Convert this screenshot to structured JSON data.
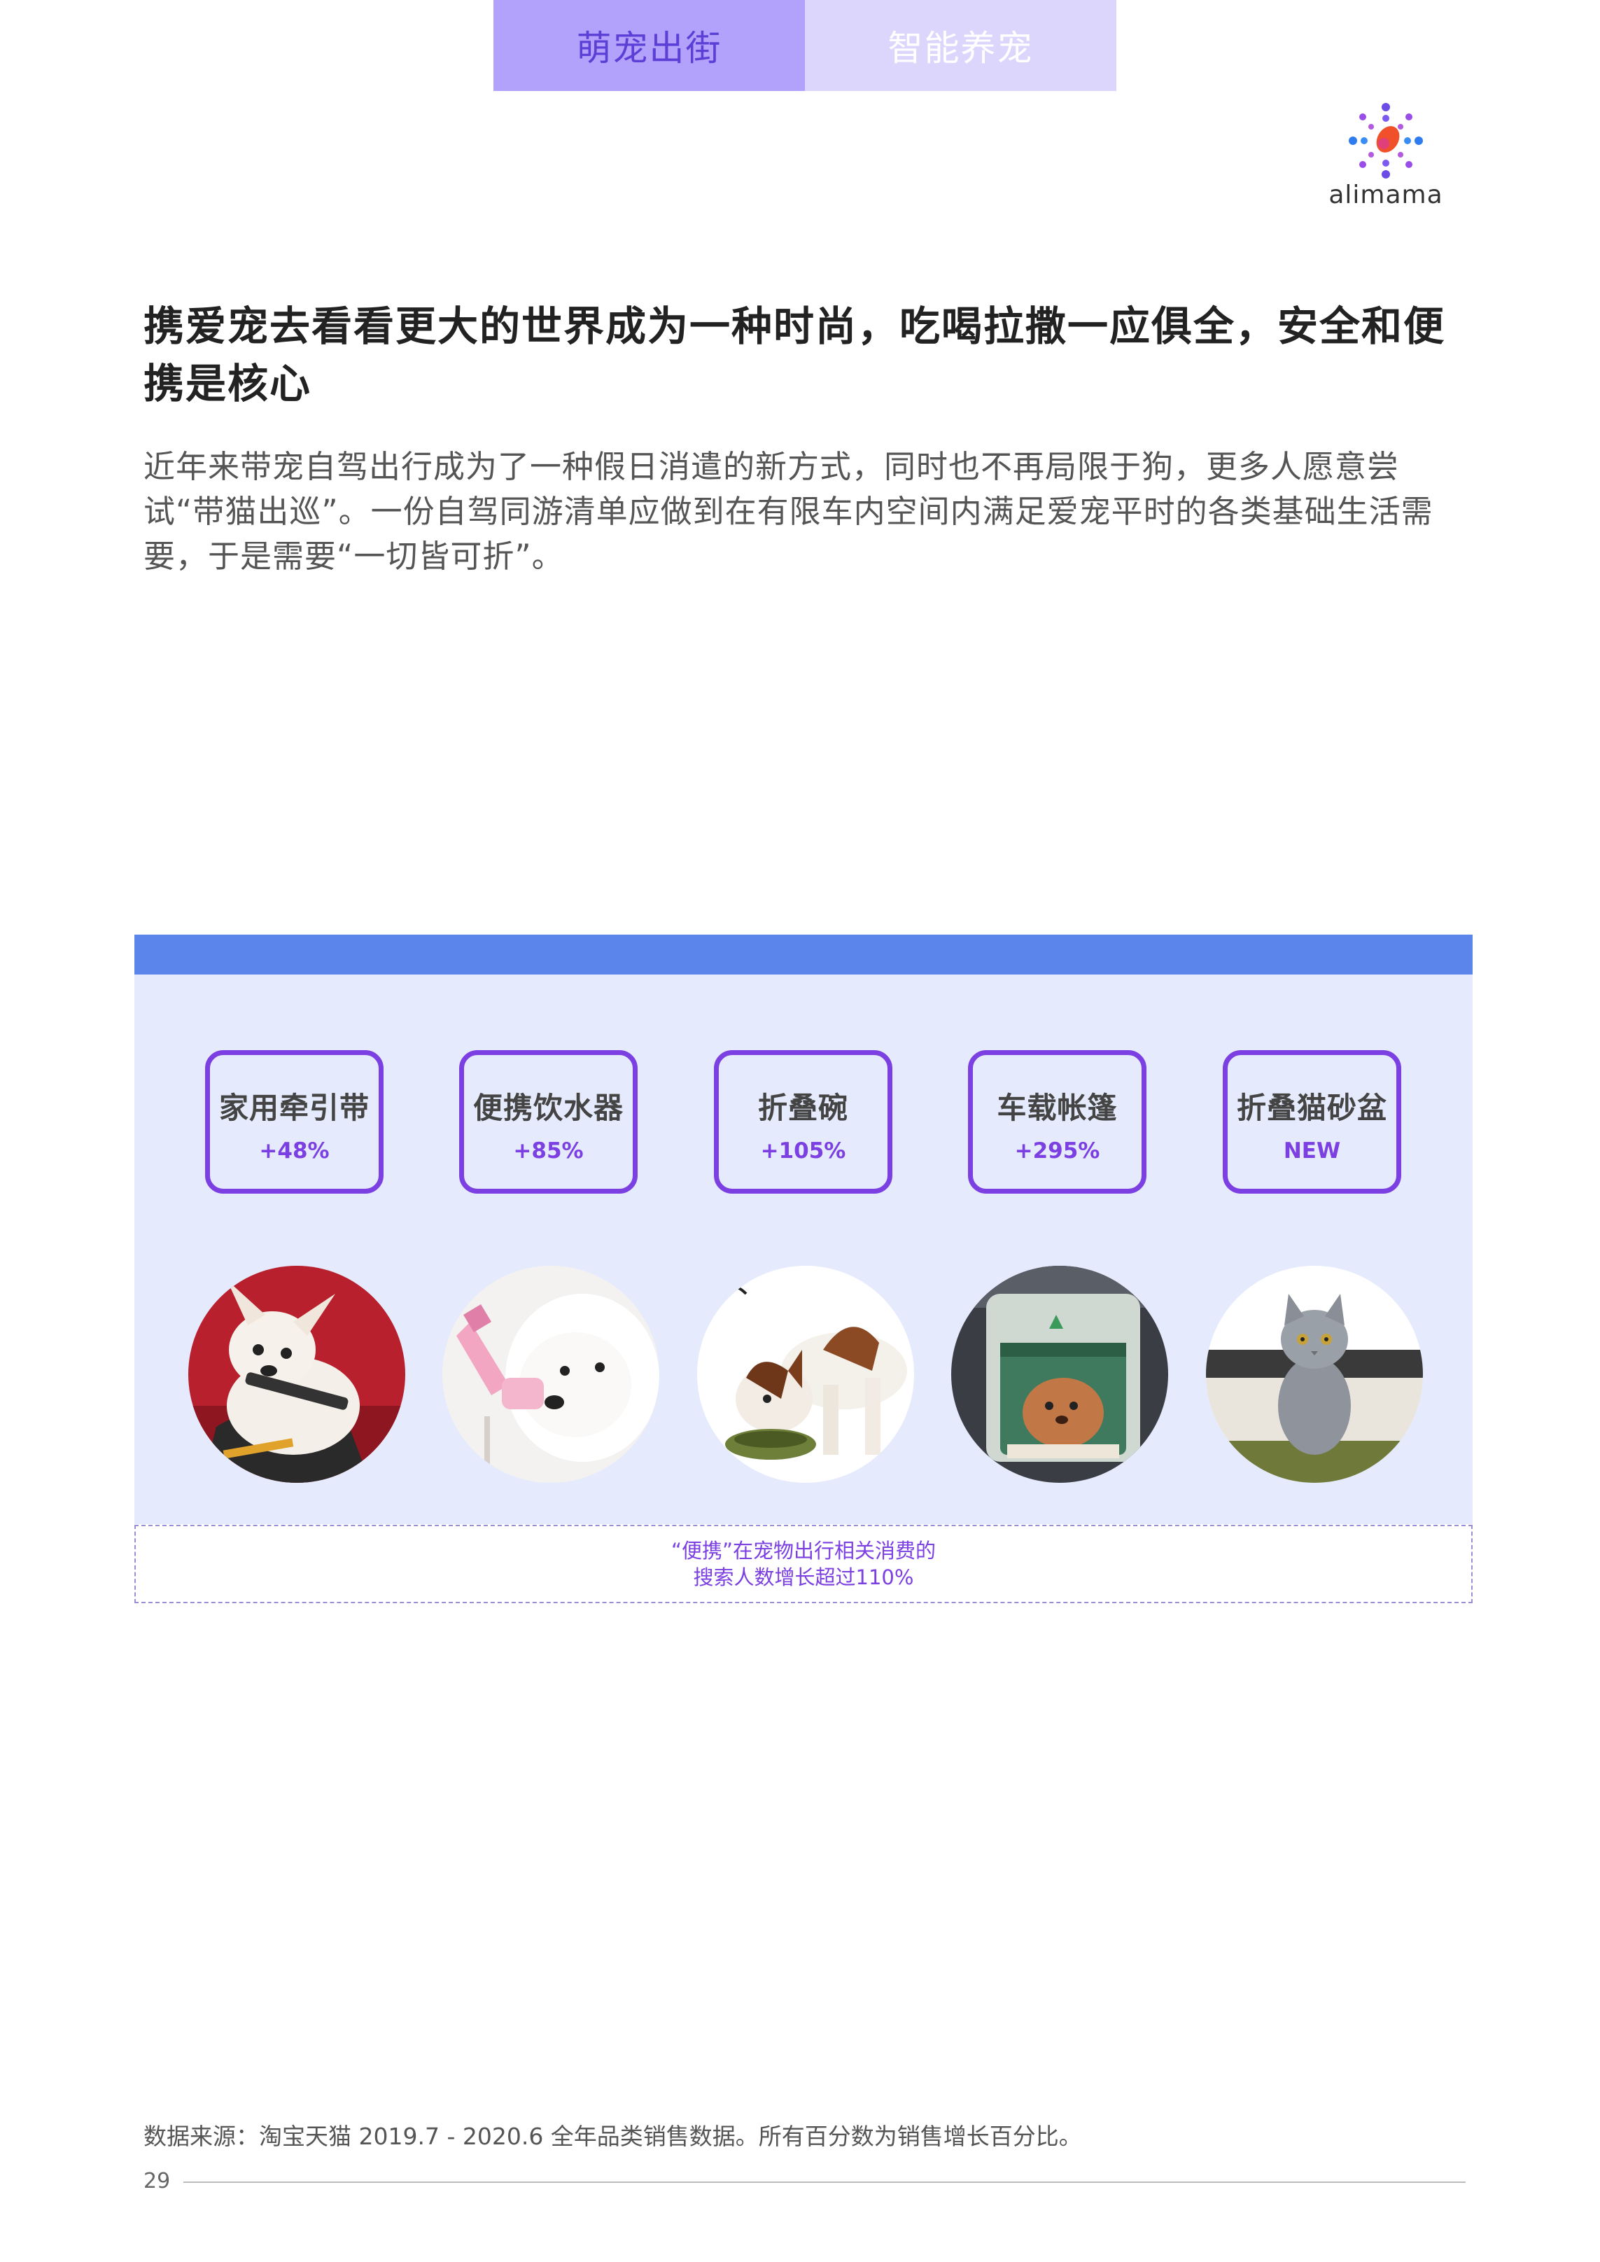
{
  "tabs": [
    {
      "label": "萌宠出街",
      "active": true
    },
    {
      "label": "智能养宠",
      "active": false
    }
  ],
  "logo": {
    "text": "alimama",
    "icon": "alimama-logo-icon"
  },
  "headline": "携爱宠去看看更大的世界成为一种时尚，吃喝拉撒一应俱全，安全和便携是核心",
  "intro": "近年来带宠自驾出行成为了一种假日消遣的新方式，同时也不再局限于狗，更多人愿意尝试“带猫出巡”。一份自驾同游清单应做到在有限车内空间内满足爱宠平时的各类基础生活需要，于是需要“一切皆可折”。",
  "products": [
    {
      "name": "家用牵引带",
      "growth": "+48%",
      "photo": "dog-in-car-seat-photo"
    },
    {
      "name": "便携饮水器",
      "growth": "+85%",
      "photo": "dog-drinking-bottle-photo"
    },
    {
      "name": "折叠碗",
      "growth": "+105%",
      "photo": "dog-eating-bowl-photo"
    },
    {
      "name": "车载帐篷",
      "growth": "+295%",
      "photo": "dog-in-car-tent-photo"
    },
    {
      "name": "折叠猫砂盆",
      "growth": "NEW",
      "photo": "cat-in-litter-box-photo"
    }
  ],
  "caption": {
    "line1": "“便携”在宠物出行相关消费的",
    "line2": "搜索人数增长超过110%"
  },
  "footer": {
    "source": "数据来源：淘宝天猫 2019.7 - 2020.6 全年品类销售数据。所有百分数为销售增长百分比。",
    "page_number": "29"
  },
  "colors": {
    "accent_purple": "#7b3fe2",
    "tab_active_bg": "#b3a2fb",
    "tab_inactive_bg": "#dcd6fd",
    "panel_bar": "#5b85ea",
    "panel_bg": "#e5ebfd"
  }
}
